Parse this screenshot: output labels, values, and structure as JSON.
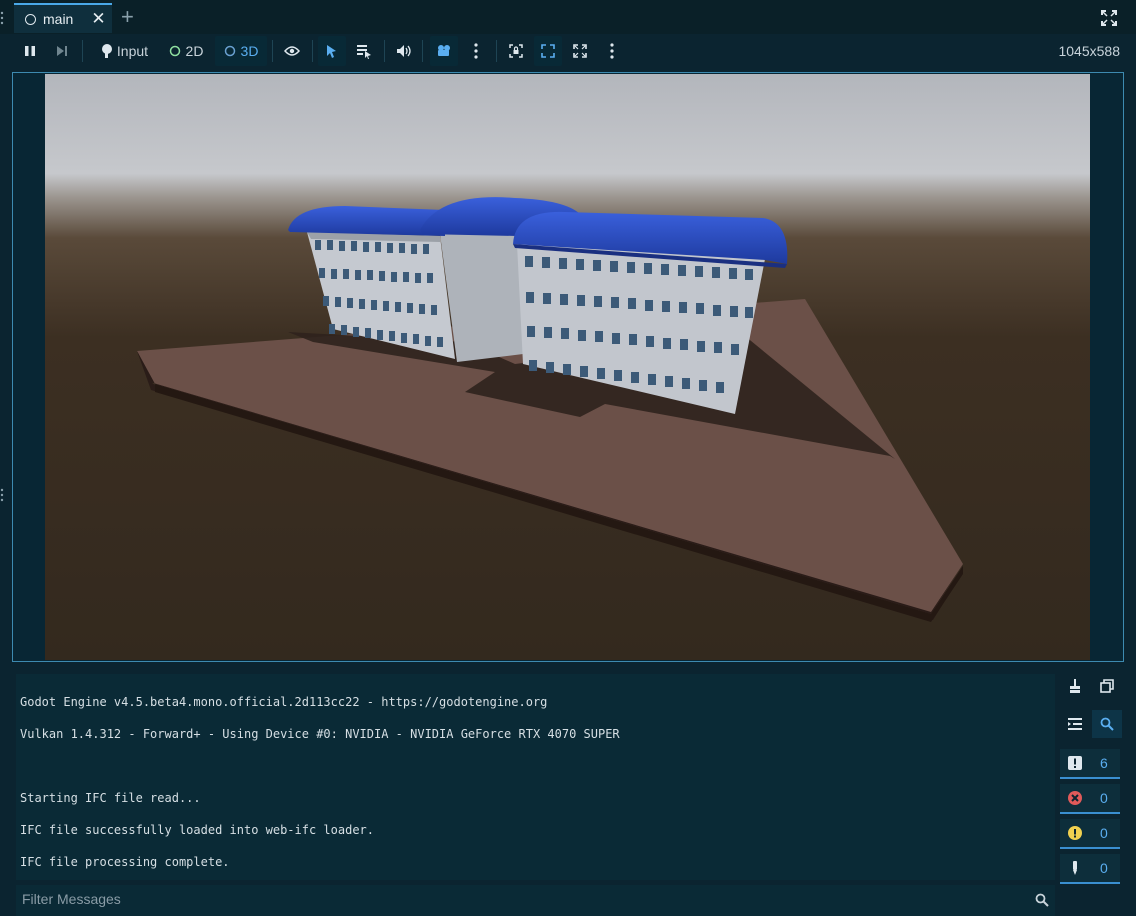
{
  "tab": {
    "title": "main"
  },
  "toolbar": {
    "input_label": "Input",
    "mode_2d_label": "2D",
    "mode_3d_label": "3D",
    "resolution": "1045x588"
  },
  "console": {
    "lines": [
      "Godot Engine v4.5.beta4.mono.official.2d113cc22 - https://godotengine.org",
      "Vulkan 1.4.312 - Forward+ - Using Device #0: NVIDIA - NVIDIA GeForce RTX 4070 SUPER",
      "",
      "Starting IFC file read...",
      "IFC file successfully loaded into web-ifc loader.",
      "IFC file processing complete."
    ],
    "filter_placeholder": "Filter Messages"
  },
  "counters": {
    "messages": "6",
    "errors": "0",
    "warnings": "0",
    "editor": "0"
  },
  "colors": {
    "accent": "#4aa8e8",
    "roof": "#2b4fc4",
    "error": "#e05a5a",
    "warning": "#f0d050"
  }
}
